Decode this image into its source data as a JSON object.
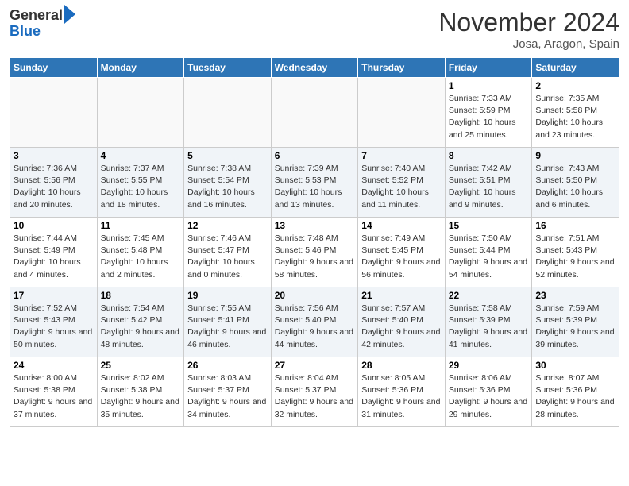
{
  "header": {
    "logo_line1": "General",
    "logo_line2": "Blue",
    "month": "November 2024",
    "location": "Josa, Aragon, Spain"
  },
  "days_of_week": [
    "Sunday",
    "Monday",
    "Tuesday",
    "Wednesday",
    "Thursday",
    "Friday",
    "Saturday"
  ],
  "weeks": [
    [
      {
        "day": "",
        "info": ""
      },
      {
        "day": "",
        "info": ""
      },
      {
        "day": "",
        "info": ""
      },
      {
        "day": "",
        "info": ""
      },
      {
        "day": "",
        "info": ""
      },
      {
        "day": "1",
        "info": "Sunrise: 7:33 AM\nSunset: 5:59 PM\nDaylight: 10 hours and 25 minutes."
      },
      {
        "day": "2",
        "info": "Sunrise: 7:35 AM\nSunset: 5:58 PM\nDaylight: 10 hours and 23 minutes."
      }
    ],
    [
      {
        "day": "3",
        "info": "Sunrise: 7:36 AM\nSunset: 5:56 PM\nDaylight: 10 hours and 20 minutes."
      },
      {
        "day": "4",
        "info": "Sunrise: 7:37 AM\nSunset: 5:55 PM\nDaylight: 10 hours and 18 minutes."
      },
      {
        "day": "5",
        "info": "Sunrise: 7:38 AM\nSunset: 5:54 PM\nDaylight: 10 hours and 16 minutes."
      },
      {
        "day": "6",
        "info": "Sunrise: 7:39 AM\nSunset: 5:53 PM\nDaylight: 10 hours and 13 minutes."
      },
      {
        "day": "7",
        "info": "Sunrise: 7:40 AM\nSunset: 5:52 PM\nDaylight: 10 hours and 11 minutes."
      },
      {
        "day": "8",
        "info": "Sunrise: 7:42 AM\nSunset: 5:51 PM\nDaylight: 10 hours and 9 minutes."
      },
      {
        "day": "9",
        "info": "Sunrise: 7:43 AM\nSunset: 5:50 PM\nDaylight: 10 hours and 6 minutes."
      }
    ],
    [
      {
        "day": "10",
        "info": "Sunrise: 7:44 AM\nSunset: 5:49 PM\nDaylight: 10 hours and 4 minutes."
      },
      {
        "day": "11",
        "info": "Sunrise: 7:45 AM\nSunset: 5:48 PM\nDaylight: 10 hours and 2 minutes."
      },
      {
        "day": "12",
        "info": "Sunrise: 7:46 AM\nSunset: 5:47 PM\nDaylight: 10 hours and 0 minutes."
      },
      {
        "day": "13",
        "info": "Sunrise: 7:48 AM\nSunset: 5:46 PM\nDaylight: 9 hours and 58 minutes."
      },
      {
        "day": "14",
        "info": "Sunrise: 7:49 AM\nSunset: 5:45 PM\nDaylight: 9 hours and 56 minutes."
      },
      {
        "day": "15",
        "info": "Sunrise: 7:50 AM\nSunset: 5:44 PM\nDaylight: 9 hours and 54 minutes."
      },
      {
        "day": "16",
        "info": "Sunrise: 7:51 AM\nSunset: 5:43 PM\nDaylight: 9 hours and 52 minutes."
      }
    ],
    [
      {
        "day": "17",
        "info": "Sunrise: 7:52 AM\nSunset: 5:43 PM\nDaylight: 9 hours and 50 minutes."
      },
      {
        "day": "18",
        "info": "Sunrise: 7:54 AM\nSunset: 5:42 PM\nDaylight: 9 hours and 48 minutes."
      },
      {
        "day": "19",
        "info": "Sunrise: 7:55 AM\nSunset: 5:41 PM\nDaylight: 9 hours and 46 minutes."
      },
      {
        "day": "20",
        "info": "Sunrise: 7:56 AM\nSunset: 5:40 PM\nDaylight: 9 hours and 44 minutes."
      },
      {
        "day": "21",
        "info": "Sunrise: 7:57 AM\nSunset: 5:40 PM\nDaylight: 9 hours and 42 minutes."
      },
      {
        "day": "22",
        "info": "Sunrise: 7:58 AM\nSunset: 5:39 PM\nDaylight: 9 hours and 41 minutes."
      },
      {
        "day": "23",
        "info": "Sunrise: 7:59 AM\nSunset: 5:39 PM\nDaylight: 9 hours and 39 minutes."
      }
    ],
    [
      {
        "day": "24",
        "info": "Sunrise: 8:00 AM\nSunset: 5:38 PM\nDaylight: 9 hours and 37 minutes."
      },
      {
        "day": "25",
        "info": "Sunrise: 8:02 AM\nSunset: 5:38 PM\nDaylight: 9 hours and 35 minutes."
      },
      {
        "day": "26",
        "info": "Sunrise: 8:03 AM\nSunset: 5:37 PM\nDaylight: 9 hours and 34 minutes."
      },
      {
        "day": "27",
        "info": "Sunrise: 8:04 AM\nSunset: 5:37 PM\nDaylight: 9 hours and 32 minutes."
      },
      {
        "day": "28",
        "info": "Sunrise: 8:05 AM\nSunset: 5:36 PM\nDaylight: 9 hours and 31 minutes."
      },
      {
        "day": "29",
        "info": "Sunrise: 8:06 AM\nSunset: 5:36 PM\nDaylight: 9 hours and 29 minutes."
      },
      {
        "day": "30",
        "info": "Sunrise: 8:07 AM\nSunset: 5:36 PM\nDaylight: 9 hours and 28 minutes."
      }
    ]
  ]
}
